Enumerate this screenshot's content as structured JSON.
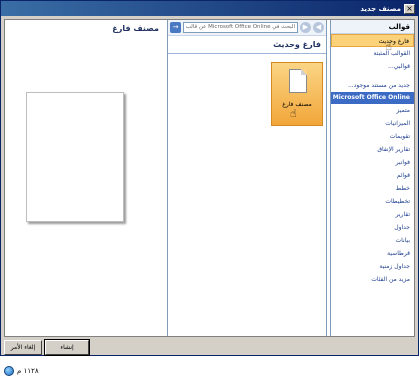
{
  "window": {
    "title": "مصنف جديد",
    "close_glyph": "×"
  },
  "templates": {
    "header": "قوالب",
    "items": [
      {
        "label": "فارغ وحديث",
        "selected": true
      },
      {
        "label": "القوالب المثبتة",
        "selected": false
      },
      {
        "label": "قوالبي...",
        "selected": false
      },
      {
        "label": "جديد من مستند موجود...",
        "selected": false
      }
    ],
    "online_section": "Microsoft Office Online",
    "online_items": [
      "متميز",
      "الميزانيات",
      "تقويمات",
      "تقارير الإنفاق",
      "فواتير",
      "قوائم",
      "خطط",
      "تخطيطات",
      "تقارير",
      "جداول",
      "بيانات",
      "قرطاسية",
      "جداول زمنية",
      "مزيد من الفئات"
    ]
  },
  "middle": {
    "search_placeholder": "البحث في Microsoft Office Online عن قالب",
    "back_glyph": "◀",
    "forward_glyph": "▶",
    "go_glyph": "→",
    "header": "فارغ وحديث",
    "tile_label": "مصنف فارغ"
  },
  "preview": {
    "header": "مصنف فارغ"
  },
  "footer": {
    "create_label": "إنشاء",
    "cancel_label": "إلغاء الأمر"
  },
  "status": {
    "text": "١١٢٨ م"
  }
}
